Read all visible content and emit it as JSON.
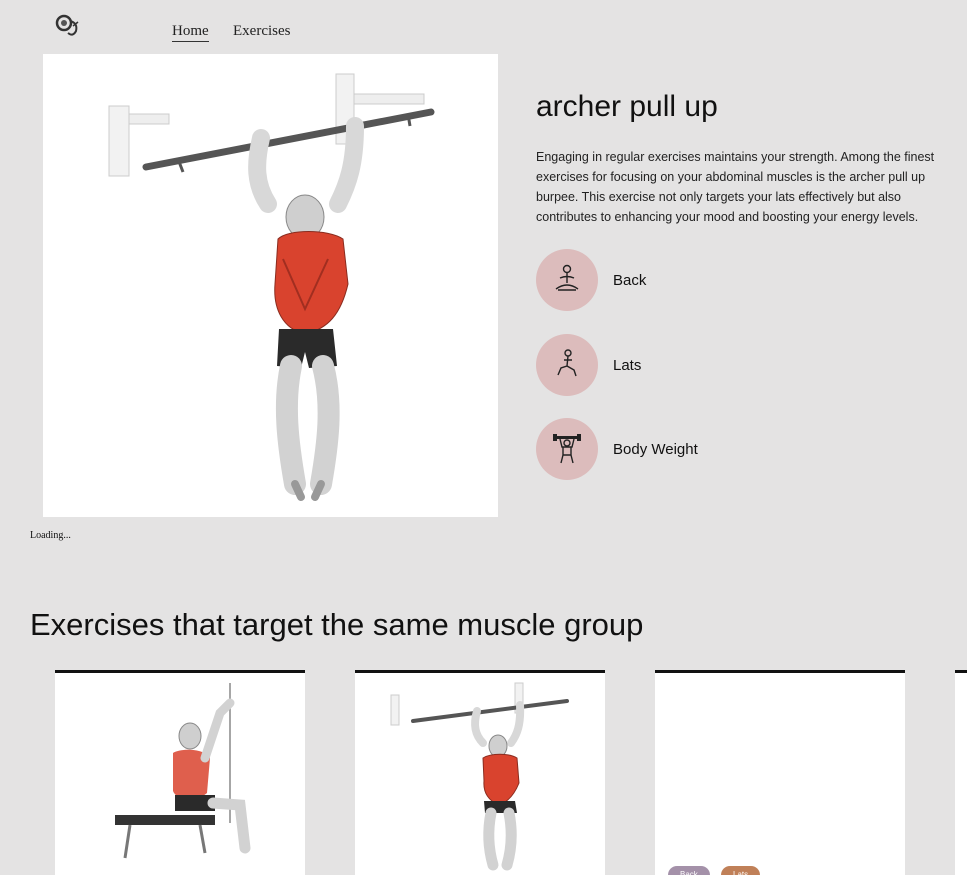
{
  "nav": {
    "logo_icon": "logo-icon",
    "links": [
      {
        "label": "Home",
        "active": true
      },
      {
        "label": "Exercises",
        "active": false
      }
    ]
  },
  "exercise": {
    "name": "archer pull up",
    "description": "Engaging in regular exercises maintains your strength. Among the finest exercises for focusing on your abdominal muscles is the archer pull up burpee. This exercise not only targets your lats effectively but also contributes to enhancing your mood and boosting your energy levels.",
    "tags": [
      {
        "label": "Back",
        "icon": "meditation-pose-icon"
      },
      {
        "label": "Lats",
        "icon": "lunge-pose-icon"
      },
      {
        "label": "Body Weight",
        "icon": "dumbbell-lift-icon"
      }
    ]
  },
  "status": {
    "loading_text": "Loading..."
  },
  "similar": {
    "heading": "Exercises that target the same muscle group",
    "cards": [
      {
        "pills": []
      },
      {
        "pills": []
      },
      {
        "pills": [
          "Back",
          "Lats"
        ]
      }
    ]
  },
  "colors": {
    "background": "#e4e3e3",
    "tag_circle": "#dcbcbc",
    "pill_back": "#a491a9",
    "pill_lats": "#c08058",
    "muscle_highlight": "#d9432e"
  }
}
